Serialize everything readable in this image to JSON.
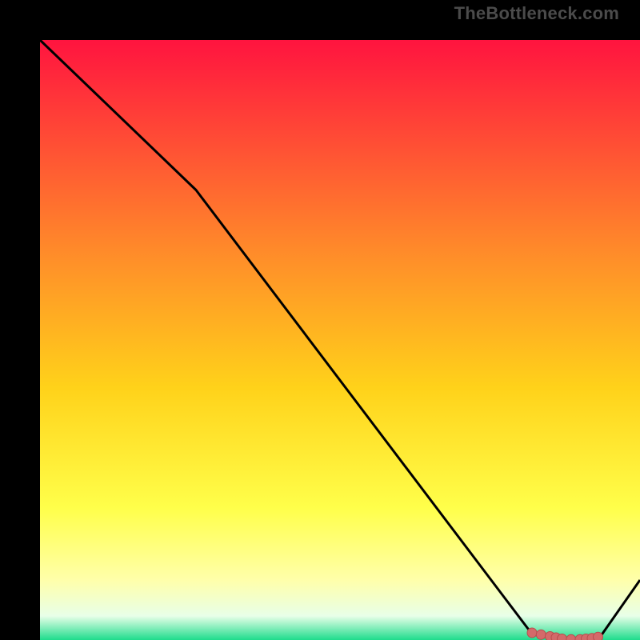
{
  "attribution": "TheBottleneck.com",
  "chart_data": {
    "type": "line",
    "title": "",
    "xlabel": "",
    "ylabel": "",
    "xlim": [
      0,
      100
    ],
    "ylim": [
      0,
      100
    ],
    "x": [
      0,
      26,
      82,
      87,
      93,
      100
    ],
    "values": [
      100,
      75,
      1,
      0,
      0,
      10
    ],
    "markers": {
      "x": [
        82,
        83.5,
        85,
        86,
        87,
        88.5,
        90,
        91,
        92,
        93
      ],
      "values": [
        1.2,
        0.9,
        0.6,
        0.4,
        0.2,
        0.1,
        0.1,
        0.2,
        0.3,
        0.5
      ]
    },
    "grid": false,
    "legend": false
  },
  "colors": {
    "gradient_top": "#ff143f",
    "gradient_mid1": "#ff8a2a",
    "gradient_mid2": "#ffd21a",
    "gradient_mid3": "#ffff4a",
    "gradient_mid4": "#ffffaa",
    "gradient_bottom_pale": "#e8ffe8",
    "gradient_bottom": "#1edc8c",
    "line": "#000000",
    "marker_fill": "#d36a6a",
    "marker_stroke": "#b84d4d",
    "frame": "#000000"
  }
}
